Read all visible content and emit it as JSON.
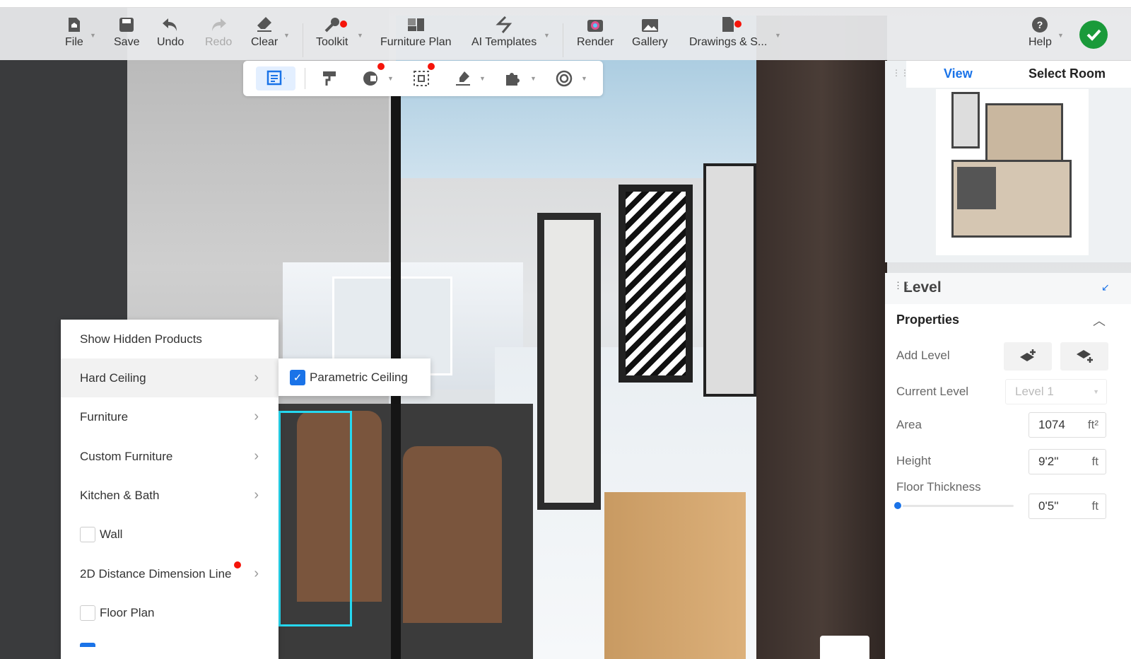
{
  "toolbar": {
    "items": [
      {
        "label": "File",
        "icon": "file-icon"
      },
      {
        "label": "Save",
        "icon": "save-icon"
      },
      {
        "label": "Undo",
        "icon": "undo-icon"
      },
      {
        "label": "Redo",
        "icon": "redo-icon"
      },
      {
        "label": "Clear",
        "icon": "eraser-icon"
      },
      {
        "label": "Toolkit",
        "icon": "wrench-icon"
      },
      {
        "label": "Furniture Plan",
        "icon": "furniture-plan-icon"
      },
      {
        "label": "AI Templates",
        "icon": "ai-templates-icon"
      },
      {
        "label": "Render",
        "icon": "camera-icon"
      },
      {
        "label": "Gallery",
        "icon": "image-icon"
      },
      {
        "label": "Drawings & S...",
        "icon": "drawings-icon"
      },
      {
        "label": "Help",
        "icon": "help-icon"
      }
    ]
  },
  "menu": {
    "items": [
      {
        "label": "Show Hidden Products"
      },
      {
        "label": "Hard Ceiling"
      },
      {
        "label": "Furniture"
      },
      {
        "label": "Custom Furniture"
      },
      {
        "label": "Kitchen & Bath"
      },
      {
        "label": "Wall"
      },
      {
        "label": "2D Distance Dimension Line"
      },
      {
        "label": "Floor Plan"
      }
    ]
  },
  "submenu": {
    "label": "Parametric Ceiling",
    "checked": true
  },
  "panel": {
    "tabs": [
      "View",
      "Select Room"
    ],
    "level_title": "Level",
    "properties": "Properties",
    "add_level": "Add Level",
    "current_level_label": "Current Level",
    "current_level": "Level 1",
    "area_label": "Area",
    "area": "1074",
    "area_unit": "ft²",
    "height_label": "Height",
    "height": "9'2''",
    "height_unit": "ft",
    "floor_label": "Floor Thickness",
    "floor": "0'5''",
    "floor_unit": "ft",
    "floor_slider": 0
  },
  "colors": {
    "accent": "#1a73e8",
    "confirm": "#1a9a3a",
    "badge": "#f5140a"
  }
}
